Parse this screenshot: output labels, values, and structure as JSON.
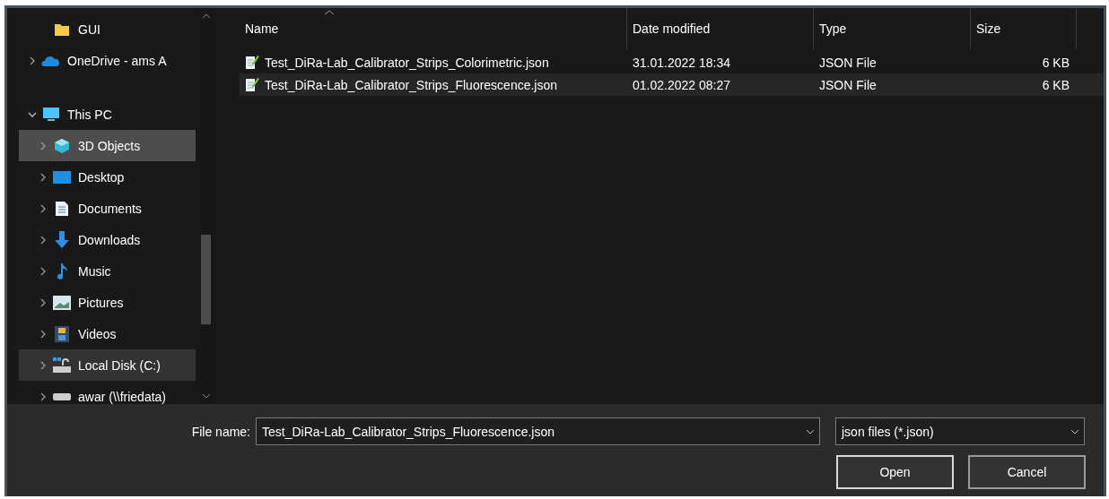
{
  "navigation": {
    "items": [
      {
        "label": "GUI",
        "kind": "folder",
        "selected": false,
        "hover": false
      },
      {
        "label": "OneDrive - ams A",
        "kind": "cloud",
        "expanded": false,
        "selected": false,
        "hover": false
      },
      {
        "label": "This PC",
        "kind": "pc",
        "expanded": true,
        "selected": false,
        "hover": false,
        "children": [
          {
            "label": "3D Objects",
            "kind": "cube",
            "expanded": false,
            "selected": true,
            "hover": false
          },
          {
            "label": "Desktop",
            "kind": "desktop",
            "expanded": false,
            "selected": false,
            "hover": false
          },
          {
            "label": "Documents",
            "kind": "document",
            "expanded": false,
            "selected": false,
            "hover": false
          },
          {
            "label": "Downloads",
            "kind": "download",
            "expanded": false,
            "selected": false,
            "hover": false
          },
          {
            "label": "Music",
            "kind": "music",
            "expanded": false,
            "selected": false,
            "hover": false
          },
          {
            "label": "Pictures",
            "kind": "pictures",
            "expanded": false,
            "selected": false,
            "hover": false
          },
          {
            "label": "Videos",
            "kind": "videos",
            "expanded": false,
            "selected": false,
            "hover": false
          },
          {
            "label": "Local Disk (C:)",
            "kind": "disk",
            "expanded": false,
            "selected": false,
            "hover": true
          },
          {
            "label": "awar (\\\\friedata)",
            "kind": "drive",
            "expanded": false,
            "selected": false,
            "hover": false
          }
        ]
      }
    ]
  },
  "file_list": {
    "columns": [
      "Name",
      "Date modified",
      "Type",
      "Size"
    ],
    "rows": [
      {
        "name": "Test_DiRa-Lab_Calibrator_Strips_Colorimetric.json",
        "date_modified": "31.01.2022 18:34",
        "type": "JSON File",
        "size": "6 KB",
        "selected": false
      },
      {
        "name": "Test_DiRa-Lab_Calibrator_Strips_Fluorescence.json",
        "date_modified": "01.02.2022 08:27",
        "type": "JSON File",
        "size": "6 KB",
        "selected": true
      }
    ]
  },
  "footer": {
    "file_name_label": "File name:",
    "file_name_value": "Test_DiRa-Lab_Calibrator_Strips_Fluorescence.json",
    "file_type": "json files (*.json)",
    "buttons": [
      "Open",
      "Cancel"
    ]
  }
}
